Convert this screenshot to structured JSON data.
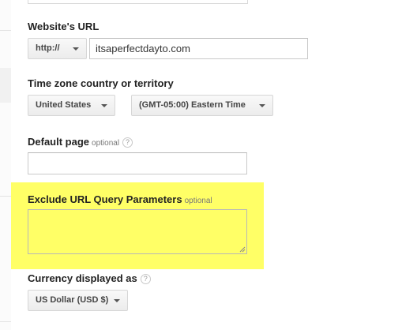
{
  "website_url": {
    "label": "Website's URL",
    "protocol": "http://",
    "value": "itsaperfectdayto.com"
  },
  "timezone": {
    "label": "Time zone country or territory",
    "country": "United States",
    "zone": "(GMT-05:00) Eastern Time"
  },
  "default_page": {
    "label": "Default page",
    "optional": "optional",
    "help": "?",
    "value": ""
  },
  "exclude_params": {
    "label": "Exclude URL Query Parameters",
    "optional": "optional",
    "value": "",
    "highlight_color": "#ffff66"
  },
  "currency": {
    "label": "Currency displayed as",
    "help": "?",
    "value": "US Dollar (USD $)"
  }
}
